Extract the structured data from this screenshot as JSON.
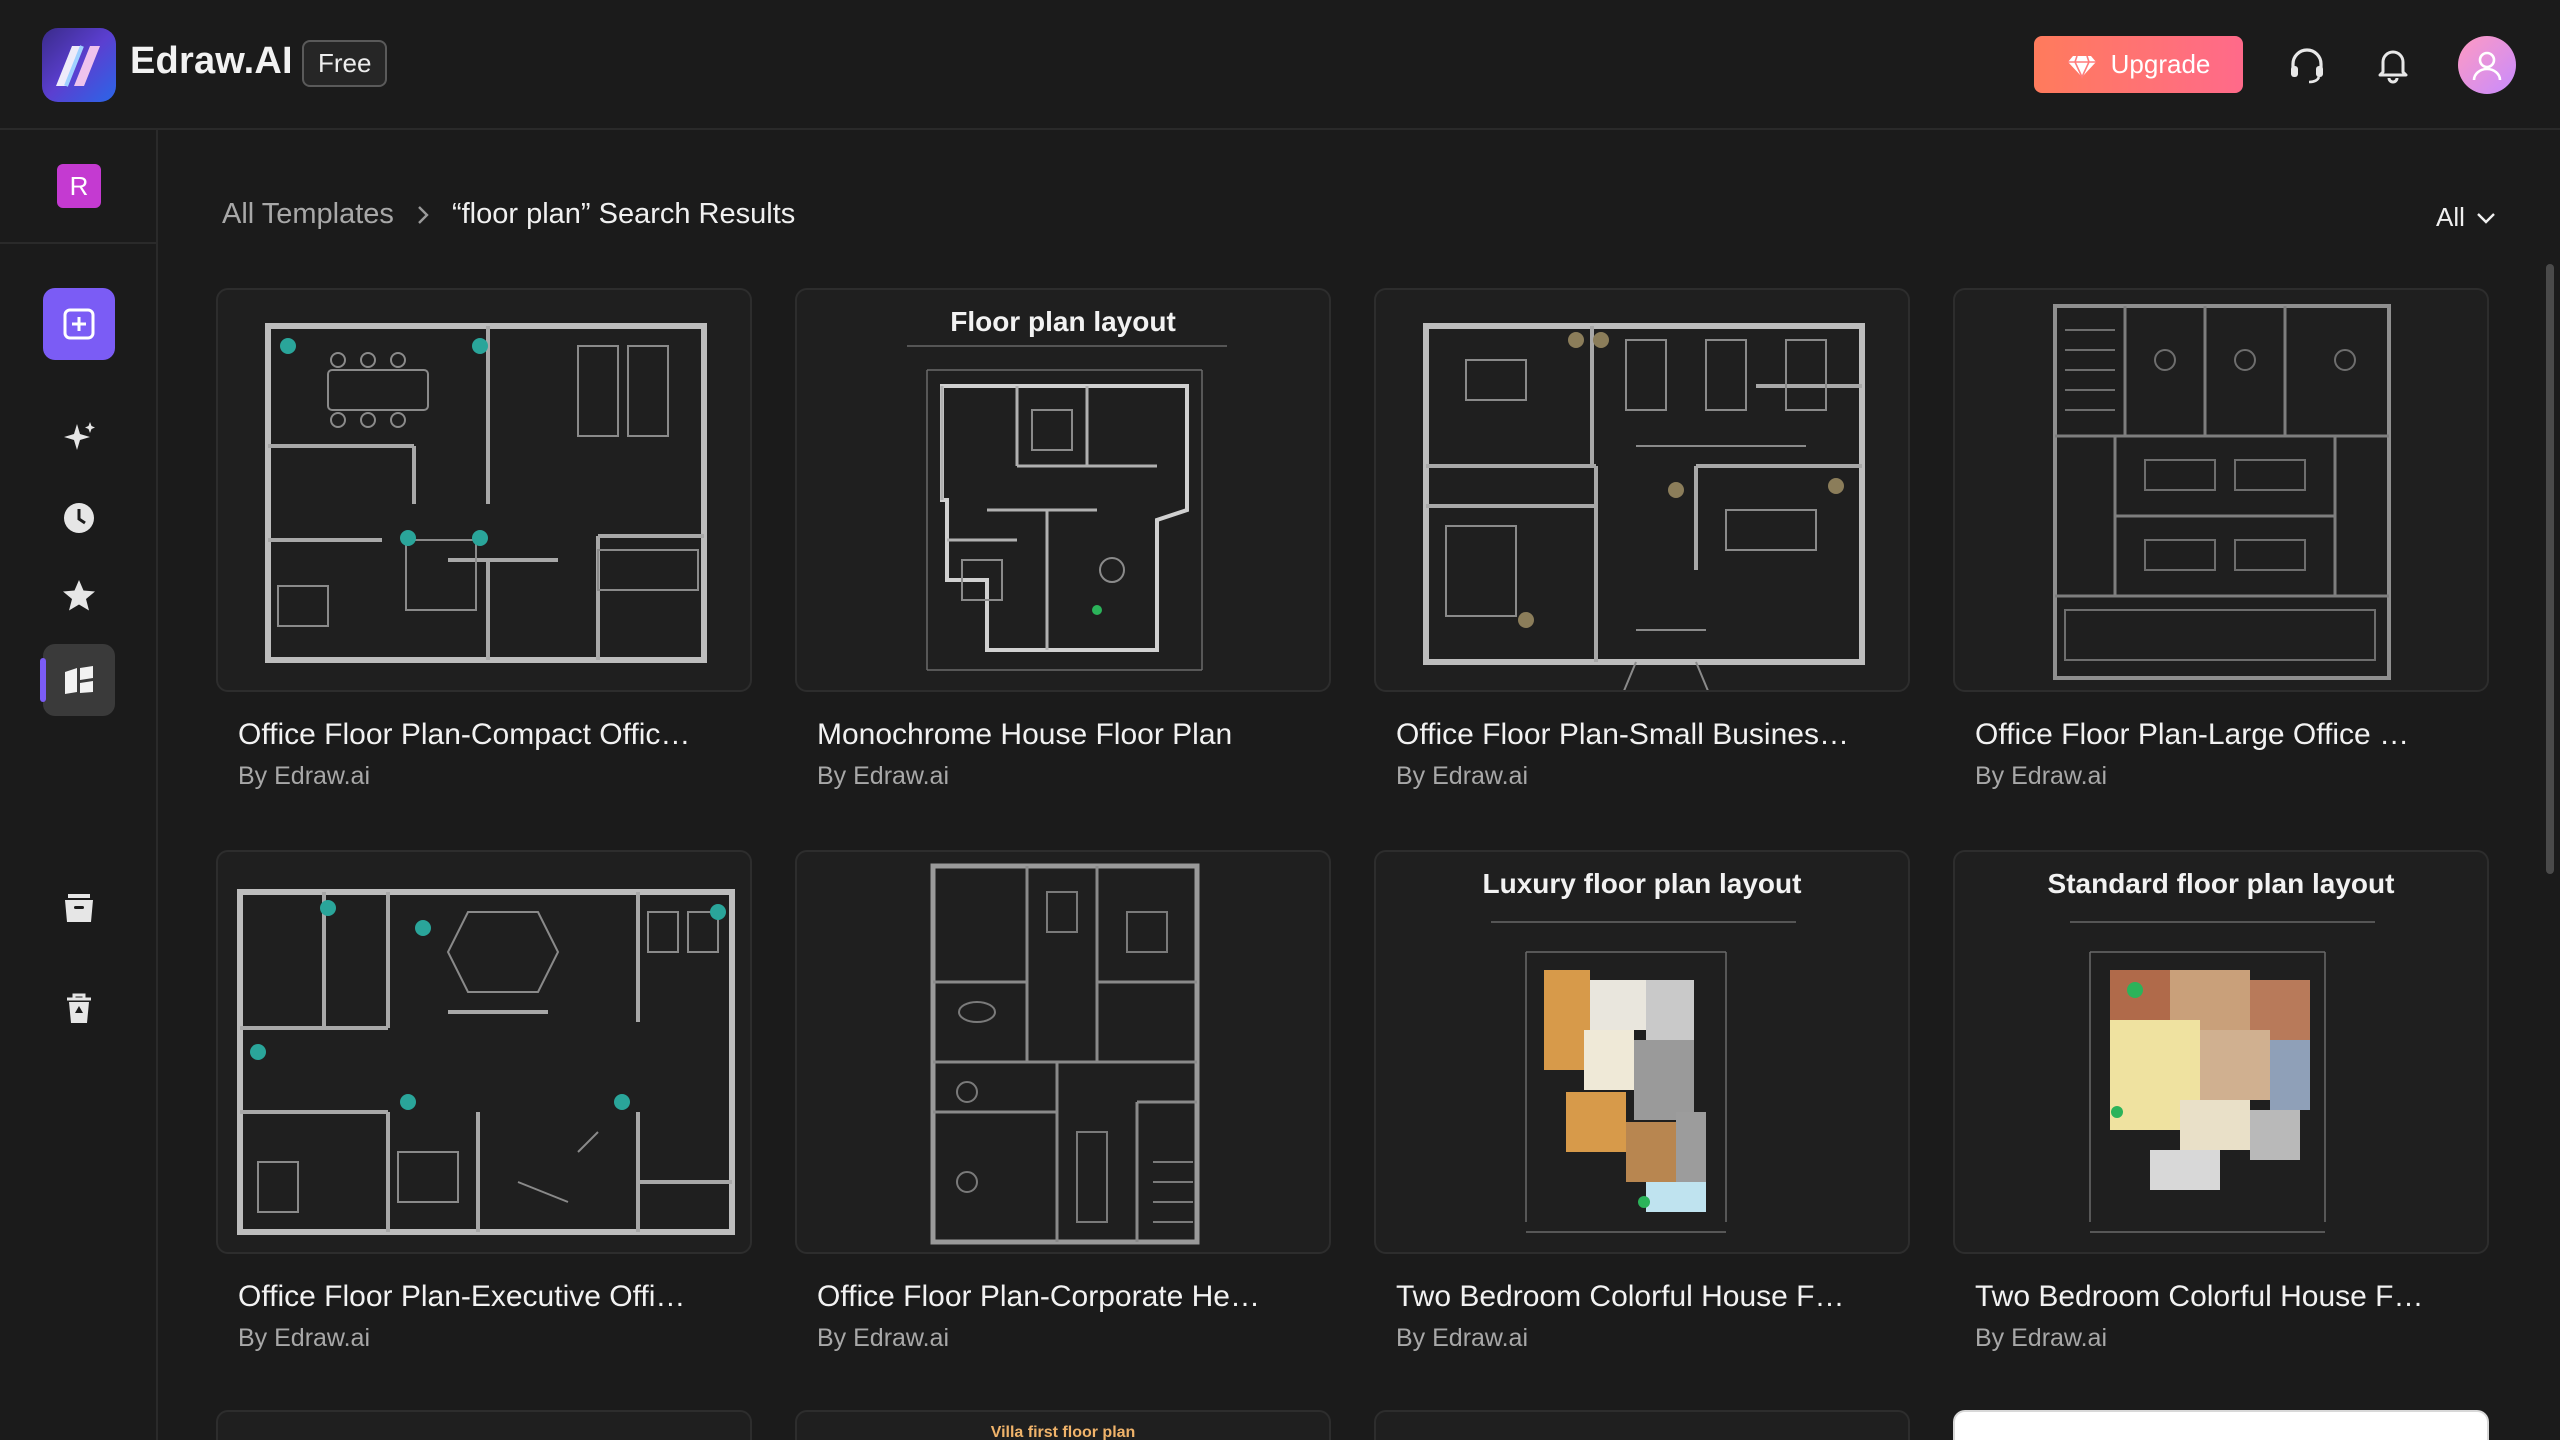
{
  "app": {
    "brand": "Edraw.AI",
    "plan_badge": "Free",
    "upgrade_label": "Upgrade",
    "progress": 0.2,
    "accent": "#7b5cf5",
    "upgrade_gradient": [
      "#ff7b5c",
      "#ff6a8a"
    ]
  },
  "header": {
    "icons": [
      "headset-icon",
      "bell-icon",
      "avatar"
    ]
  },
  "sidebar": {
    "workspace_initial": "R",
    "items": [
      {
        "icon": "new-file-icon",
        "active": false
      },
      {
        "icon": "sparkle-icon",
        "active": false
      },
      {
        "icon": "clock-icon",
        "active": false
      },
      {
        "icon": "star-icon",
        "active": false
      },
      {
        "icon": "templates-icon",
        "active": true
      },
      {
        "icon": "folder-icon",
        "active": false
      },
      {
        "icon": "trash-icon",
        "active": false
      }
    ]
  },
  "main": {
    "breadcrumb_root": "All Templates",
    "breadcrumb_sep": ">",
    "breadcrumb_current": "“floor plan” Search Results",
    "filter_label": "All",
    "cards": [
      {
        "title": "Office Floor Plan-Compact Offic…",
        "author": "By Edraw.ai",
        "thumb_title": "",
        "style": "office"
      },
      {
        "title": "Monochrome House Floor Plan",
        "author": "By Edraw.ai",
        "thumb_title": "Floor plan layout",
        "style": "house"
      },
      {
        "title": "Office Floor Plan-Small Busines…",
        "author": "By Edraw.ai",
        "thumb_title": "",
        "style": "office"
      },
      {
        "title": "Office Floor Plan-Large Office …",
        "author": "By Edraw.ai",
        "thumb_title": "",
        "style": "office"
      },
      {
        "title": "Office Floor Plan-Executive Offi…",
        "author": "By Edraw.ai",
        "thumb_title": "",
        "style": "office"
      },
      {
        "title": "Office Floor Plan-Corporate He…",
        "author": "By Edraw.ai",
        "thumb_title": "",
        "style": "office"
      },
      {
        "title": "Two Bedroom Colorful House F…",
        "author": "By Edraw.ai",
        "thumb_title": "Luxury floor plan layout",
        "style": "color"
      },
      {
        "title": "Two Bedroom Colorful House F…",
        "author": "By Edraw.ai",
        "thumb_title": "Standard floor plan layout",
        "style": "color"
      }
    ],
    "partial_cards": [
      {
        "thumb_title": ""
      },
      {
        "thumb_title": "Villa first floor plan"
      },
      {
        "thumb_title": ""
      },
      {
        "thumb_title": "",
        "white": true
      }
    ]
  }
}
